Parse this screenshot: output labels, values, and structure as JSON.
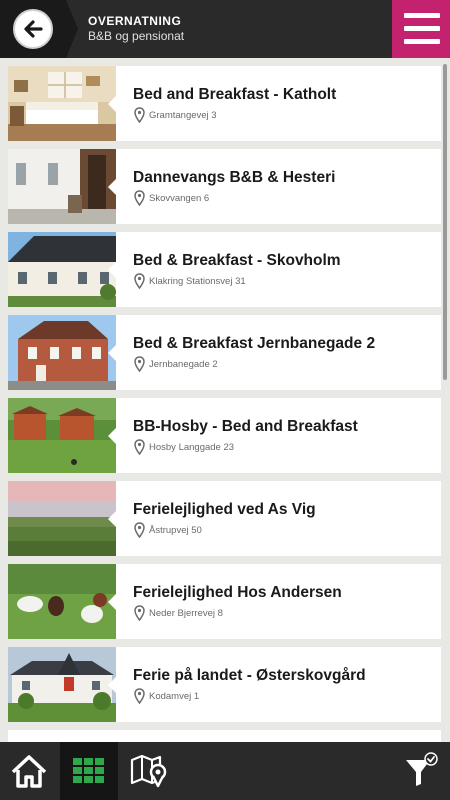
{
  "header": {
    "title": "OVERNATNING",
    "subtitle": "B&B og pensionat"
  },
  "items": [
    {
      "title": "Bed and Breakfast - Katholt",
      "address": "Gramtangevej 3"
    },
    {
      "title": "Dannevangs B&B & Hesteri",
      "address": "Skovvangen 6"
    },
    {
      "title": "Bed & Breakfast - Skovholm",
      "address": "Klakring Stationsvej 31"
    },
    {
      "title": "Bed & Breakfast Jernbanegade 2",
      "address": "Jernbanegade 2"
    },
    {
      "title": "BB-Hosby - Bed and Breakfast",
      "address": "Hosby Langgade 23"
    },
    {
      "title": "Ferielejlighed ved As Vig",
      "address": "Åstrupvej 50"
    },
    {
      "title": "Ferielejlighed Hos Andersen",
      "address": "Neder Bjerrevej 8"
    },
    {
      "title": "Ferie på landet - Østerskovgård",
      "address": "Kodamvej 1"
    }
  ],
  "icons": {
    "back": "back-arrow-icon",
    "menu": "hamburger-menu-icon",
    "pin": "map-pin-icon",
    "home": "home-icon",
    "grid": "grid-view-icon",
    "map": "map-icon",
    "filter": "filter-icon"
  },
  "colors": {
    "accent": "#c2226e",
    "grid_active": "#2ea84a",
    "header_bg": "#2a2a2a"
  }
}
